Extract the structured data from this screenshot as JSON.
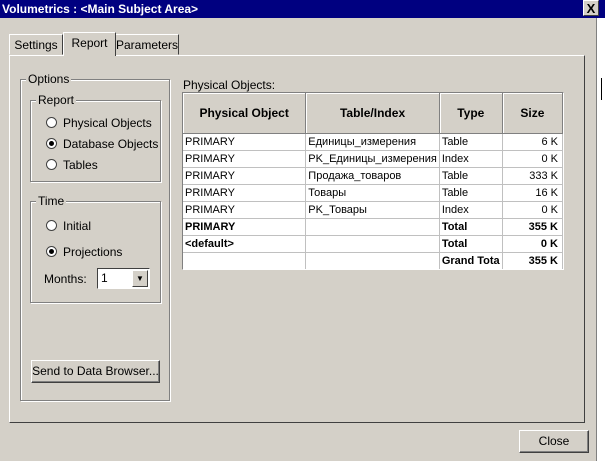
{
  "window": {
    "title": "Volumetrics : <Main Subject Area>",
    "close_glyph": "X"
  },
  "tabs": [
    {
      "label": "Settings"
    },
    {
      "label": "Report"
    },
    {
      "label": "Parameters"
    }
  ],
  "options": {
    "legend": "Options",
    "report": {
      "legend": "Report",
      "items": [
        {
          "label": "Physical Objects",
          "selected": false
        },
        {
          "label": "Database Objects",
          "selected": true
        },
        {
          "label": "Tables",
          "selected": false
        }
      ]
    },
    "time": {
      "legend": "Time",
      "items": [
        {
          "label": "Initial",
          "selected": false
        },
        {
          "label": "Projections",
          "selected": true
        }
      ],
      "months_label": "Months:",
      "months_value": "1"
    },
    "send_button": "Send to Data Browser..."
  },
  "physical_objects": {
    "label": "Physical Objects:",
    "columns": [
      "Physical Object",
      "Table/Index",
      "Type",
      "Size"
    ],
    "rows": [
      {
        "object": "PRIMARY",
        "table": "Единицы_измерения",
        "type": "Table",
        "size": "6 K",
        "bold": false
      },
      {
        "object": "PRIMARY",
        "table": "PK_Единицы_измерения",
        "type": "Index",
        "size": "0 K",
        "bold": false
      },
      {
        "object": "PRIMARY",
        "table": "Продажа_товаров",
        "type": "Table",
        "size": "333 K",
        "bold": false
      },
      {
        "object": "PRIMARY",
        "table": "Товары",
        "type": "Table",
        "size": "16 K",
        "bold": false
      },
      {
        "object": "PRIMARY",
        "table": "PK_Товары",
        "type": "Index",
        "size": "0 K",
        "bold": false
      },
      {
        "object": "PRIMARY",
        "table": "",
        "type": "Total",
        "size": "355 K",
        "bold": true
      },
      {
        "object": "<default>",
        "table": "",
        "type": "Total",
        "size": "0 K",
        "bold": true
      },
      {
        "object": "",
        "table": "",
        "type": "Grand Tota",
        "size": "355 K",
        "bold": true
      }
    ]
  },
  "footer": {
    "close_button": "Close"
  }
}
